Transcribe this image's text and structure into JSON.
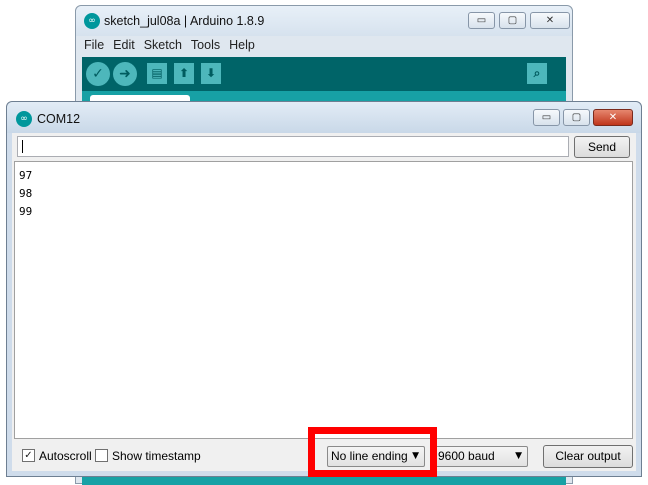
{
  "ide": {
    "title": "sketch_jul08a | Arduino 1.8.9",
    "menu": [
      "File",
      "Edit",
      "Sketch",
      "Tools",
      "Help"
    ],
    "window_buttons": {
      "minimize": "▭",
      "maximize": "▢",
      "close": "✕"
    }
  },
  "serial_monitor": {
    "title": "COM12",
    "window_buttons": {
      "minimize": "▭",
      "maximize": "▢",
      "close": "✕"
    },
    "input_value": "",
    "send_label": "Send",
    "output_lines": [
      "97",
      "98",
      "99"
    ],
    "autoscroll": {
      "label": "Autoscroll",
      "checked": true,
      "mark": "✓"
    },
    "show_timestamp": {
      "label": "Show timestamp",
      "checked": false
    },
    "line_ending": {
      "selected": "No line ending"
    },
    "baud_rate": {
      "selected": "9600 baud"
    },
    "clear_label": "Clear output",
    "dropdown_arrow": "▼"
  },
  "colors": {
    "arduino_teal": "#006468",
    "arduino_tab_strip": "#17a1a5",
    "highlight": "#ff0000"
  }
}
